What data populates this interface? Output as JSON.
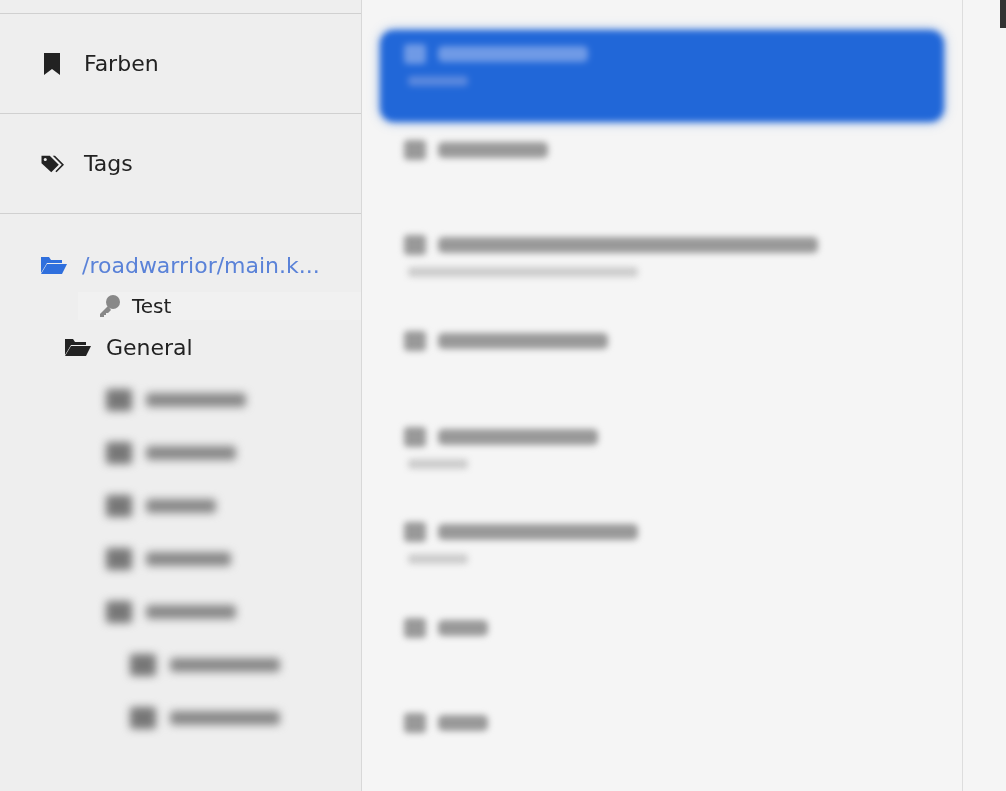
{
  "sidebar": {
    "sections": [
      {
        "label": "Farben",
        "kind": "bookmark"
      },
      {
        "label": "Tags",
        "kind": "tags"
      }
    ],
    "tree": {
      "label": "/roadwarrior/main.k...",
      "selected": true,
      "children": [
        {
          "label": "General",
          "children": [
            {
              "kind": "blurred"
            },
            {
              "kind": "blurred"
            },
            {
              "kind": "blurred"
            },
            {
              "kind": "blurred"
            },
            {
              "kind": "blurred",
              "children": [
                {
                  "kind": "blurred"
                },
                {
                  "kind": "blurred"
                }
              ]
            }
          ]
        }
      ]
    },
    "drag_ghost": {
      "label": "Test"
    }
  },
  "entries": [
    {
      "kind": "two-line",
      "selected": true
    },
    {
      "kind": "one-line",
      "selected": false
    },
    {
      "kind": "two-line",
      "selected": false
    },
    {
      "kind": "one-line",
      "selected": false
    },
    {
      "kind": "two-line",
      "selected": false
    },
    {
      "kind": "two-line",
      "selected": false
    },
    {
      "kind": "one-line",
      "selected": false
    },
    {
      "kind": "one-line",
      "selected": false
    }
  ]
}
